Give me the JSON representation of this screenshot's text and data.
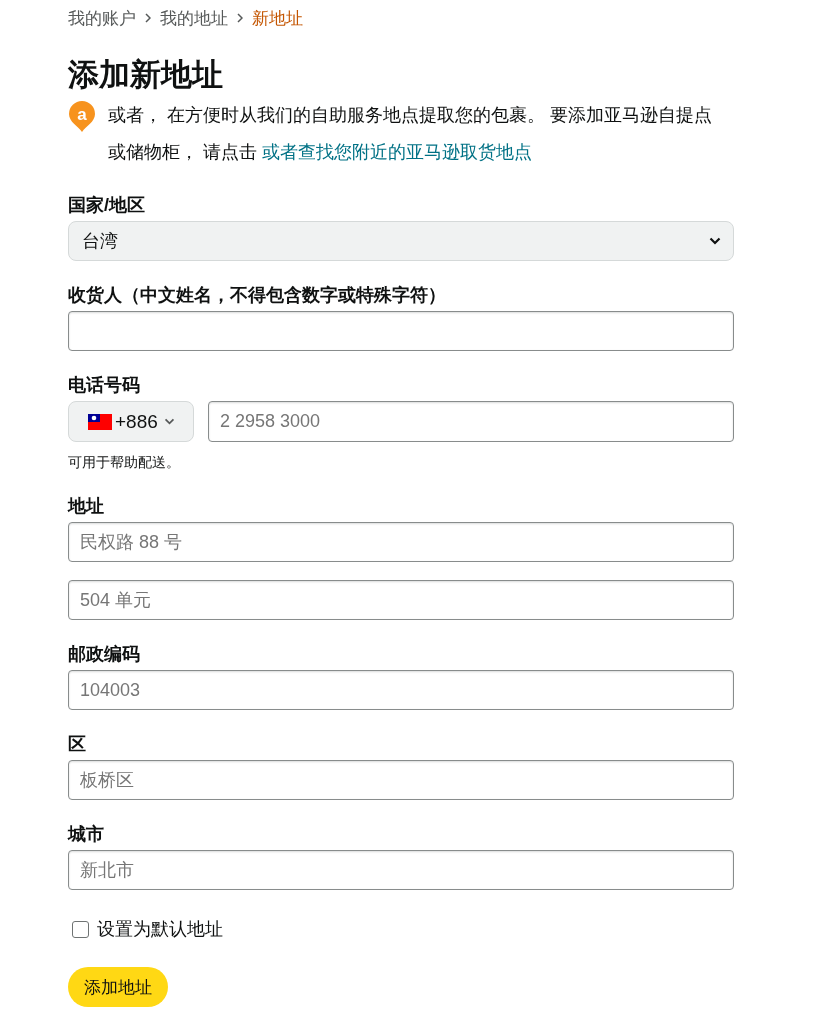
{
  "breadcrumb": [
    {
      "label": "我的账户",
      "selected": false
    },
    {
      "label": "我的地址",
      "selected": false
    },
    {
      "label": "新地址",
      "selected": true
    }
  ],
  "title": "添加新地址",
  "intro": {
    "pin_letter": "a",
    "text": "或者， 在方便时从我们的自助服务地点提取您的包裹。 要添加亚马逊自提点或储物柜， 请点击",
    "link": "或者查找您附近的亚马逊取货地点"
  },
  "fields": [
    {
      "kind": "select",
      "label": "国家/地区",
      "value": "台湾"
    },
    {
      "kind": "text",
      "label": "收货人（中文姓名，不得包含数字或特殊字符）"
    },
    {
      "kind": "phone",
      "label": "电话号码",
      "country_code": "+886",
      "placeholder": "2 2958 3000",
      "hint": "可用于帮助配送。"
    },
    {
      "kind": "text",
      "label": "地址",
      "placeholder": "民权路 88 号"
    },
    {
      "kind": "text",
      "placeholder": "504 单元"
    },
    {
      "kind": "text",
      "label": "邮政编码",
      "placeholder": "104003"
    },
    {
      "kind": "text",
      "label": "区",
      "placeholder": "板桥区"
    },
    {
      "kind": "text",
      "label": "城市",
      "placeholder": "新北市"
    }
  ],
  "default_checkbox": {
    "label": "设置为默认地址",
    "checked": false
  },
  "submit_button": {
    "label": "添加地址"
  }
}
